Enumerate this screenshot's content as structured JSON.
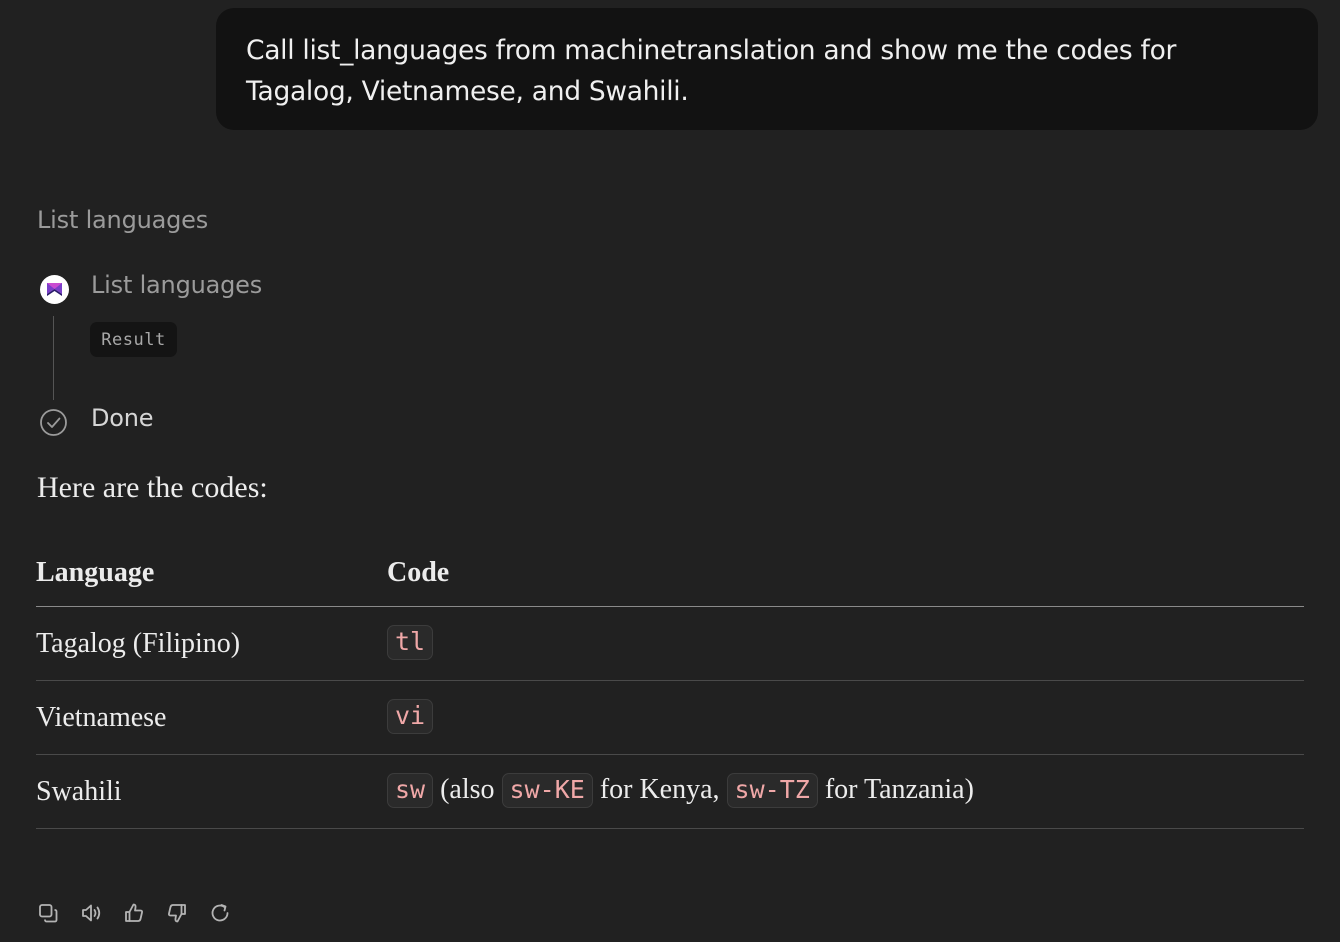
{
  "user_message": {
    "line1": "Call list_languages from machinetranslation and show me the codes for",
    "line2": "Tagalog, Vietnamese, and Swahili."
  },
  "tool_run": {
    "heading": "List languages",
    "step_label": "List languages",
    "step_icon": "app-logo-icon",
    "result_label": "Result",
    "done_label": "Done",
    "done_icon": "check-circle-icon"
  },
  "response": {
    "intro": "Here are the codes:",
    "table": {
      "headers": [
        "Language",
        "Code"
      ],
      "rows": [
        {
          "language": "Tagalog (Filipino)",
          "code": "tl"
        },
        {
          "language": "Vietnamese",
          "code": "vi"
        },
        {
          "language": "Swahili",
          "code": "sw",
          "note_1": "(also",
          "code_2": "sw-KE",
          "note_2": "for Kenya,",
          "code_3": "sw-TZ",
          "note_3": "for Tanzania)"
        }
      ]
    }
  },
  "actions": [
    {
      "name": "copy",
      "icon": "copy-icon"
    },
    {
      "name": "read-aloud",
      "icon": "speaker-icon"
    },
    {
      "name": "good-response",
      "icon": "thumbs-up-icon"
    },
    {
      "name": "bad-response",
      "icon": "thumbs-down-icon"
    },
    {
      "name": "regenerate",
      "icon": "refresh-icon"
    }
  ],
  "colors": {
    "background": "#212121",
    "user_bubble": "#121212",
    "code_text": "#f0a8a8",
    "muted_text": "#9b9b9b"
  }
}
